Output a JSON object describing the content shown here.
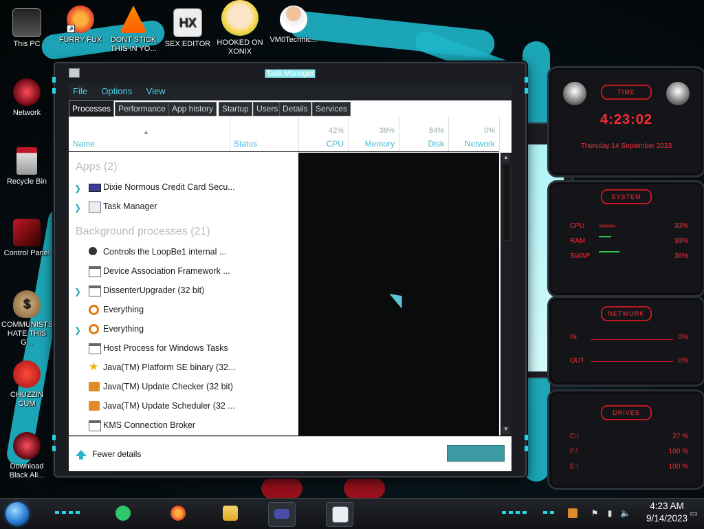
{
  "desktop": {
    "icons": [
      {
        "label": "This PC"
      },
      {
        "label": "FURRY FUX"
      },
      {
        "label": "DONT STICK THIS IN YO..."
      },
      {
        "label": "SEX EDITOR"
      },
      {
        "label": "HOOKED ON XONIX"
      },
      {
        "label": "VM0Technic..."
      },
      {
        "label": "Network"
      },
      {
        "label": "Recycle Bin"
      },
      {
        "label": "Control Panel"
      },
      {
        "label": "COMMUNISTS HATE THIS G..."
      },
      {
        "label": "CHUZZIN CUM"
      },
      {
        "label": "Download Black Ali..."
      }
    ]
  },
  "task_manager": {
    "title": "Task Manager",
    "menu": [
      "File",
      "Options",
      "View"
    ],
    "tabs": [
      "Processes",
      "Performance",
      "App history",
      "Startup",
      "Users",
      "Details",
      "Services"
    ],
    "active_tab": "Processes",
    "columns": {
      "name": "Name",
      "status": "Status",
      "cpu": {
        "pct": "42%",
        "label": "CPU"
      },
      "memory": {
        "pct": "39%",
        "label": "Memory"
      },
      "disk": {
        "pct": "84%",
        "label": "Disk"
      },
      "network": {
        "pct": "0%",
        "label": "Network"
      }
    },
    "groups": {
      "apps": "Apps (2)",
      "background": "Background processes (21)"
    },
    "apps": [
      {
        "name": "Dixie Normous Credit Card Secu...",
        "expand": true,
        "icon": "credit-card-icon"
      },
      {
        "name": "Task Manager",
        "expand": true,
        "icon": "task-manager-icon"
      }
    ],
    "background": [
      {
        "name": "Controls the LoopBe1 internal ...",
        "expand": false,
        "icon": "loopbe-icon"
      },
      {
        "name": "Device Association Framework ...",
        "expand": false,
        "icon": "window-icon"
      },
      {
        "name": "DissenterUpgrader (32 bit)",
        "expand": true,
        "icon": "window-icon"
      },
      {
        "name": "Everything",
        "expand": false,
        "icon": "magnifier-icon"
      },
      {
        "name": "Everything",
        "expand": true,
        "icon": "magnifier-icon"
      },
      {
        "name": "Host Process for Windows Tasks",
        "expand": false,
        "icon": "window-icon"
      },
      {
        "name": "Java(TM) Platform SE binary (32...",
        "expand": false,
        "icon": "java-star-icon"
      },
      {
        "name": "Java(TM) Update Checker (32 bit)",
        "expand": false,
        "icon": "java-icon"
      },
      {
        "name": "Java(TM) Update Scheduler (32 ...",
        "expand": false,
        "icon": "java-icon"
      },
      {
        "name": "KMS Connection Broker",
        "expand": false,
        "icon": "window-icon"
      }
    ],
    "footer": {
      "fewer_details": "Fewer details"
    }
  },
  "gadgets": {
    "time": {
      "head": "TIME",
      "clock": "4:23:02",
      "date": "Thursday 14 September 2023"
    },
    "system": {
      "head": "SYSTEM",
      "rows": [
        {
          "label": "CPU",
          "value": "33%"
        },
        {
          "label": "RAM",
          "value": "39%"
        },
        {
          "label": "SWAP",
          "value": "36%"
        }
      ]
    },
    "network": {
      "head": "NETWORK",
      "rows": [
        {
          "label": "IN",
          "value": "0%"
        },
        {
          "label": "OUT",
          "value": "0%"
        }
      ]
    },
    "drives": {
      "head": "DRIVES",
      "rows": [
        {
          "label": "C:\\",
          "value": "27 %"
        },
        {
          "label": "F:\\",
          "value": "100 %"
        },
        {
          "label": "E:\\",
          "value": "100 %"
        }
      ]
    }
  },
  "taskbar": {
    "time": "4:23 AM",
    "date": "9/14/2023",
    "pinned": [
      "spotify-like-app",
      "firefox",
      "file-explorer",
      "credit-card-app",
      "task-manager"
    ],
    "tray": [
      "java-update-icon",
      "flag-icon",
      "network-icon",
      "volume-icon",
      "message-icon"
    ]
  },
  "colors": {
    "accent": "#27d4e6",
    "red": "#ff2a36",
    "link": "#3fb9d4"
  }
}
